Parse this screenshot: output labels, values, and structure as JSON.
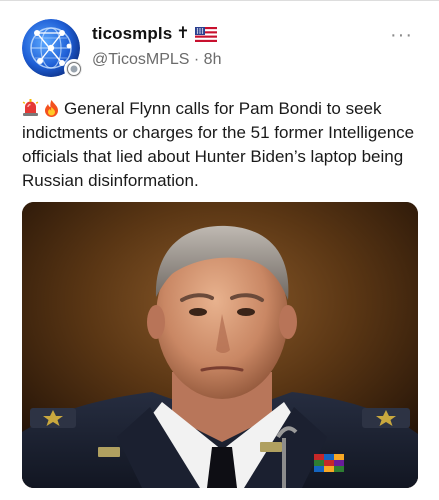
{
  "post": {
    "display_name": "ticosmpls",
    "flair": "✝",
    "handle": "@TicosMPLS",
    "separator": " · ",
    "time": "8h",
    "more_label": "···",
    "text": "General Flynn calls for Pam Bondi to seek indictments or charges for the 51 former Intelligence officials that lied about Hunter Biden’s laptop being Russian disinformation.",
    "emojis": [
      "siren-icon",
      "fire-icon"
    ]
  },
  "colors": {
    "name": "#111111",
    "handle": "#6b6b6b",
    "avatar_blue": "#1f5fd6",
    "uniform_navy": "#1c2233"
  }
}
